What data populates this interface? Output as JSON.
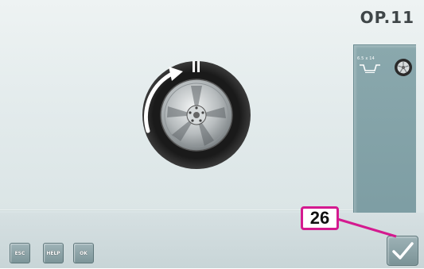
{
  "screen": {
    "operation_label": "OP.11"
  },
  "side_panel": {
    "size_text": "6.5 x 14",
    "rim_icon": "rim-profile-icon",
    "wheel_icon": "wheel-icon"
  },
  "main": {
    "wheel_icon": "tyre-rotation-icon",
    "rotation_arrow": "rotate-clockwise-arrow"
  },
  "softkeys": [
    {
      "label": "ESC"
    },
    {
      "label": "HELP"
    },
    {
      "label": "OK"
    }
  ],
  "confirm_button": {
    "icon": "checkmark-icon"
  },
  "callout": {
    "number": "26",
    "color": "#d41a8f"
  }
}
